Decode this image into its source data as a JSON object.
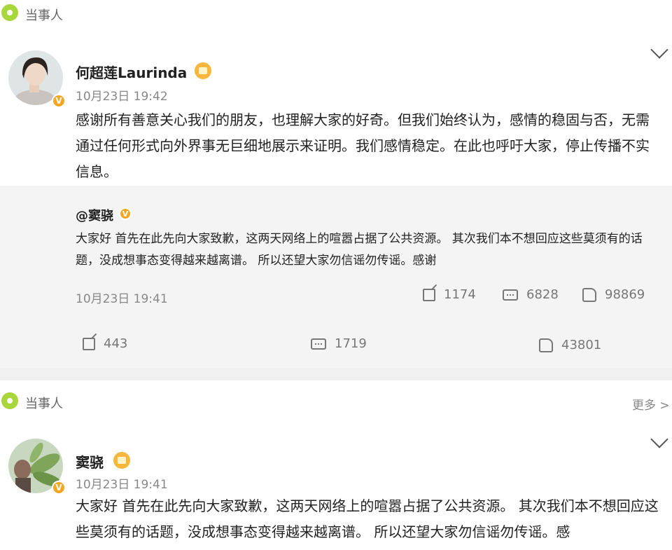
{
  "tag1": {
    "label": "当事人"
  },
  "post1": {
    "username": "何超莲Laurinda",
    "time": "10月23日 19:42",
    "text": "感谢所有善意关心我们的朋友，也理解大家的好奇。但我们始终认为，感情的稳固与否，无需通过任何形式向外界事无巨细地展示来证明。我们感情稳定。在此也呼吁大家，停止传播不实信息。",
    "repost": {
      "username": "@窦骁",
      "text": "大家好 首先在此先向大家致歉，这两天网络上的喧嚣占据了公共资源。 其次我们本不想回应这些莫须有的话题，没成想事态变得越来越离谱。 所以还望大家勿信谣勿传谣。感谢",
      "time": "10月23日 19:41",
      "shares": "1174",
      "comments": "6828",
      "likes": "98869"
    },
    "shares": "443",
    "comments": "1719",
    "likes": "43801"
  },
  "tag2": {
    "label": "当事人",
    "more": "更多 >"
  },
  "post2": {
    "username": "窦骁",
    "time": "10月23日 19:41",
    "text": "大家好 首先在此先向大家致歉，这两天网络上的喧嚣占据了公共资源。 其次我们本不想回应这些莫须有的话题，没成想事态变得越来越离谱。 所以还望大家勿信谣勿传谣。感"
  },
  "icons": {
    "tag": "location-pin-icon",
    "verified": "verified-v-icon",
    "vip": "crown-icon",
    "share": "share-icon",
    "comment": "comment-icon",
    "like": "thumbs-up-icon",
    "chevron": "chevron-down-icon"
  },
  "colors": {
    "tag_green": "#a9d63a",
    "verified_orange": "#f5a623",
    "repost_bg": "#f4f4f4"
  }
}
